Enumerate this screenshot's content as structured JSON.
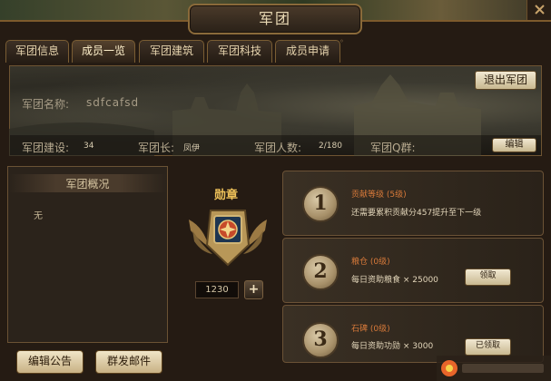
{
  "window": {
    "title": "军团"
  },
  "tabs": [
    {
      "label": "军团信息",
      "active": false
    },
    {
      "label": "成员一览",
      "active": true
    },
    {
      "label": "军团建筑",
      "active": false
    },
    {
      "label": "军团科技",
      "active": false
    },
    {
      "label": "成员申请",
      "active": false
    }
  ],
  "banner": {
    "name_label": "军团名称:",
    "name_value": "sdfcafsd",
    "leave_button": "退出军团",
    "edit_button": "编辑",
    "info": [
      {
        "label": "军团建设:",
        "value": "34"
      },
      {
        "label": "军团长:",
        "value": "凤伊"
      },
      {
        "label": "军团人数:",
        "value": "2/180"
      },
      {
        "label": "军团Q群:",
        "value": ""
      }
    ]
  },
  "overview": {
    "title": "军团概况",
    "body": "无"
  },
  "bottom_buttons": {
    "edit_notice": "编辑公告",
    "send_mail": "群发邮件"
  },
  "medal": {
    "label": "勋章",
    "count": "1230",
    "plus": "+"
  },
  "rewards": [
    {
      "number": "1",
      "title": "贡献等级 (5级)",
      "desc": "还需要累积贡献分457提升至下一级",
      "button": ""
    },
    {
      "number": "2",
      "title": "粮仓 (0级)",
      "desc": "每日资助粮食 × 25000",
      "button": "领取"
    },
    {
      "number": "3",
      "title": "石碑 (0级)",
      "desc": "每日资助功勋 × 3000",
      "button": "已领取"
    }
  ],
  "colors": {
    "accent_gold": "#f0c35a",
    "title_orange": "#d87a3a",
    "border_bronze": "#7d5a2c"
  }
}
